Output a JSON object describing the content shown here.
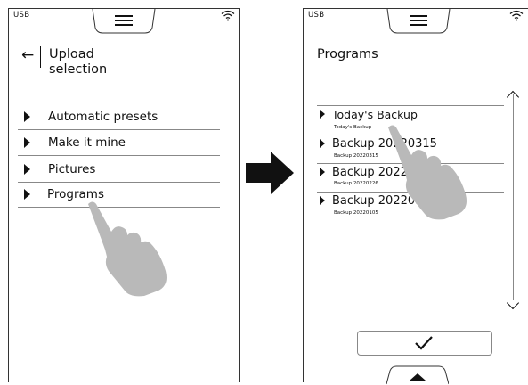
{
  "left_screen": {
    "status": {
      "usb_label": "USB",
      "wifi_icon": "wifi-icon",
      "menu_icon": "hamburger-icon"
    },
    "back_icon": "←",
    "title_line1": "Upload",
    "title_line2": "selection",
    "items": [
      {
        "label": "Automatic presets"
      },
      {
        "label": "Make it mine"
      },
      {
        "label": "Pictures"
      },
      {
        "label": "Programs"
      }
    ]
  },
  "flow_arrow_icon": "right-arrow-icon",
  "right_screen": {
    "status": {
      "usb_label": "USB",
      "wifi_icon": "wifi-icon",
      "menu_icon": "hamburger-icon"
    },
    "title": "Programs",
    "programs": [
      {
        "name": "Today's Backup",
        "sub": "Today's Backup"
      },
      {
        "name": "Backup 20220315",
        "sub": "Backup 20220315"
      },
      {
        "name": "Backup 20220226",
        "sub": "Backup 20220226"
      },
      {
        "name": "Backup 20220105",
        "sub": "Backup 20220105"
      }
    ],
    "scroll_up_icon": "chevron-up-icon",
    "scroll_down_icon": "chevron-down-icon",
    "confirm_icon": "checkmark-icon",
    "bottom_tab_icon": "up-triangle-icon"
  },
  "colors": {
    "hand": "#b9b9b9",
    "ink": "#111111",
    "divider": "#888888"
  }
}
